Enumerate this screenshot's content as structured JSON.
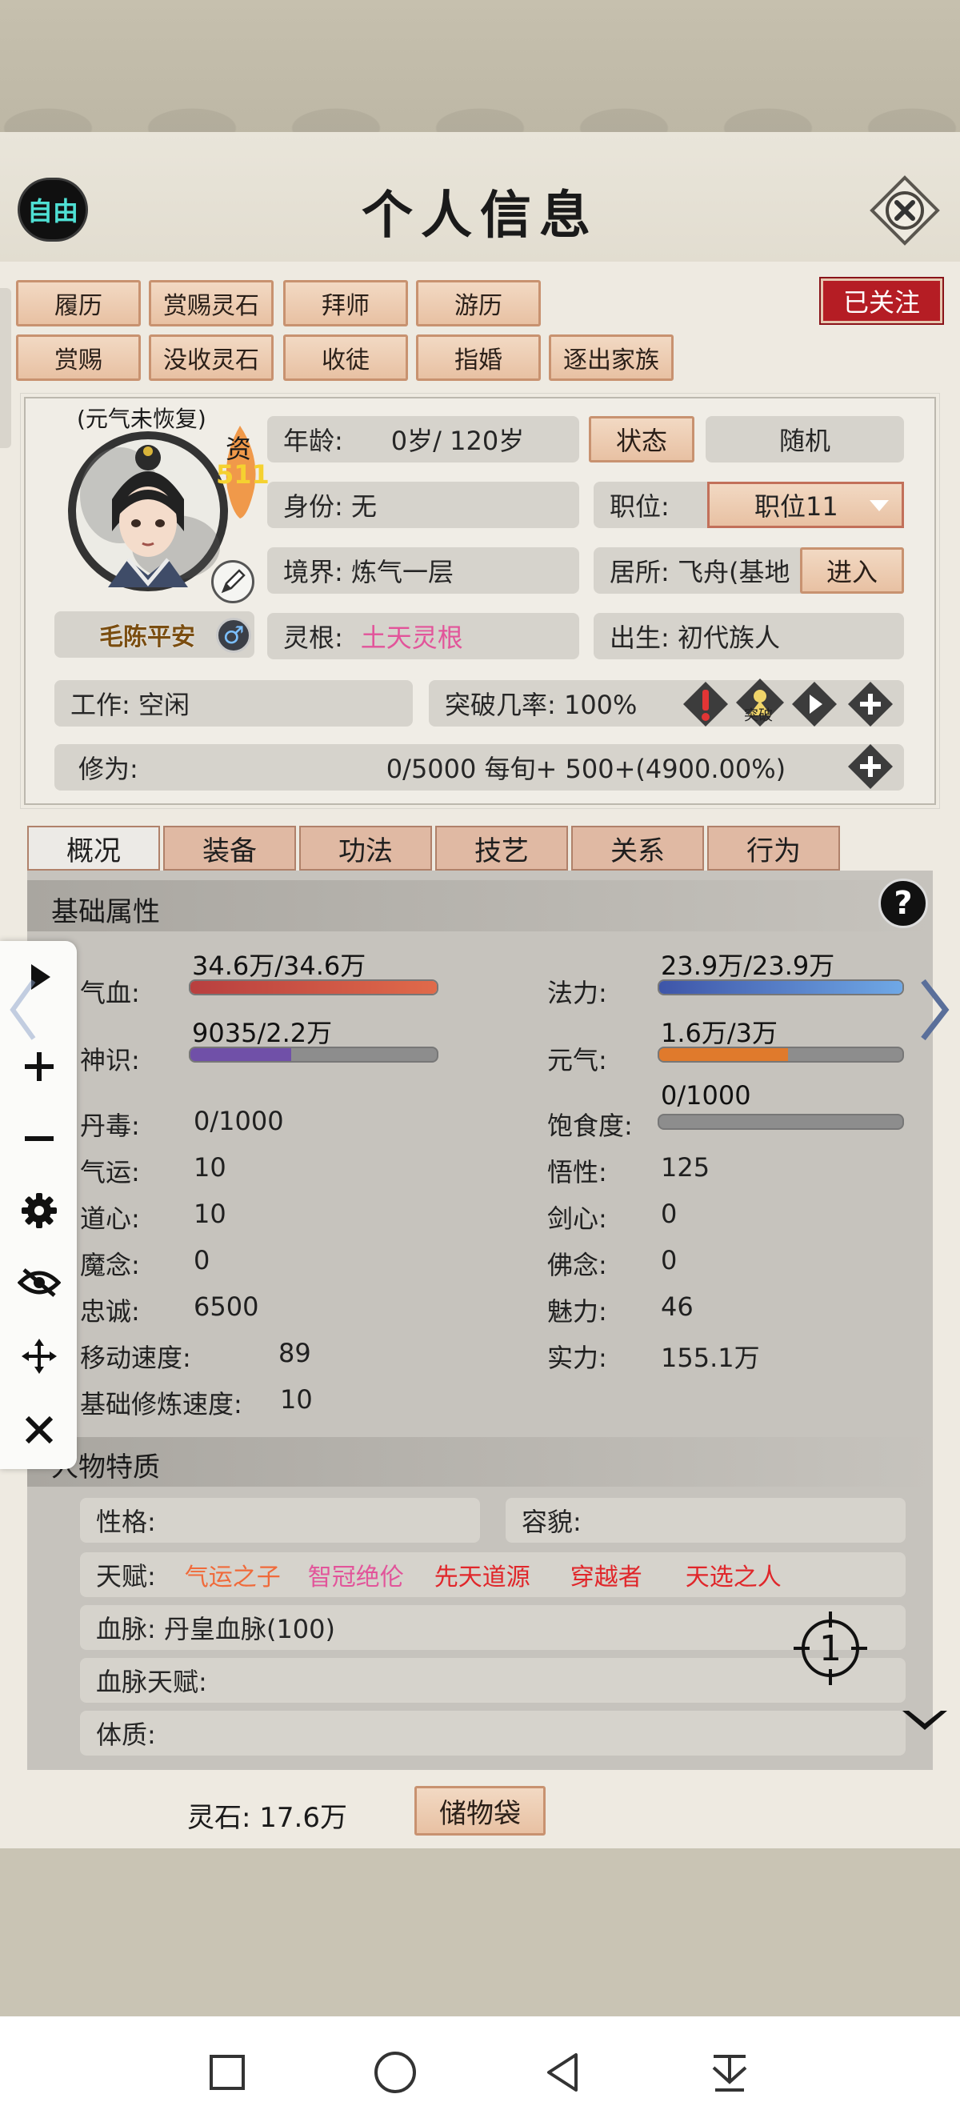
{
  "header": {
    "title": "个人信息",
    "free_badge": "自由",
    "followed_badge": "已关注"
  },
  "actions": {
    "row1": [
      "履历",
      "赏赐灵石",
      "拜师",
      "游历"
    ],
    "row2": [
      "赏赐",
      "没收灵石",
      "收徒",
      "指婚",
      "逐出家族"
    ]
  },
  "profile": {
    "status_note": "(元气未恢复)",
    "aptitude_label": "资",
    "aptitude_value": "511",
    "name": "毛陈平安",
    "age_label": "年龄:",
    "age_value": "0岁/ 120岁",
    "status_button": "状态",
    "random_button": "随机",
    "identity": "身份:  无",
    "position_label": "职位:",
    "position_value": "职位11",
    "realm": "境界:  炼气一层",
    "residence": "居所: 飞舟(基地",
    "enter_button": "进入",
    "root_label": "灵根:",
    "root_value": "土天灵根",
    "birth": "出生:   初代族人",
    "work": "工作: 空闲",
    "breakthrough": "突破几率:  100%",
    "breakthrough_tag": "突破",
    "cultivation_label": "修为:",
    "cultivation_value": "0/5000  每旬+   500+(4900.00%)"
  },
  "tabs": [
    "概况",
    "装备",
    "功法",
    "技艺",
    "关系",
    "行为"
  ],
  "attributes": {
    "section_title": "基础属性",
    "help": "?",
    "blood_label": "气血:",
    "blood_value": "34.6万/34.6万",
    "blood_fill": 1.0,
    "mana_label": "法力:",
    "mana_value": "23.9万/23.9万",
    "mana_fill": 1.0,
    "sense_label": "神识:",
    "sense_value": "9035/2.2万",
    "sense_fill": 0.41,
    "vital_label": "元气:",
    "vital_value": "1.6万/3万",
    "vital_fill": 0.53,
    "toxin": "丹毒:",
    "toxin_value": "0/1000",
    "satiety_label": "饱食度:",
    "satiety_value": "0/1000",
    "satiety_fill": 0.0,
    "luck": "气运:",
    "luck_value": "10",
    "comprehension": "悟性:",
    "comprehension_value": "125",
    "dao_heart": "道心:",
    "dao_heart_value": "10",
    "sword_heart": "剑心:",
    "sword_heart_value": "0",
    "demon": "魔念:",
    "demon_value": "0",
    "buddha": "佛念:",
    "buddha_value": "0",
    "loyalty": "忠诚:",
    "loyalty_value": "6500",
    "charm": "魅力:",
    "charm_value": "46",
    "move_speed": "移动速度:",
    "move_speed_value": "89",
    "strength": "实力:",
    "strength_value": "155.1万",
    "base_speed": "基础修炼速度:",
    "base_speed_value": "10"
  },
  "traits": {
    "section_title": "人物特质",
    "personality": "性格:",
    "looks": "容貌:",
    "talent_label": "天赋:",
    "talents": [
      "气运之子",
      "智冠绝伦",
      "先天道源",
      "穿越者",
      "天选之人"
    ],
    "bloodline": "血脉:  丹皇血脉(100)",
    "bloodline_talent": "血脉天赋:",
    "physique": "体质:"
  },
  "footer": {
    "spirit_stone": "灵石: 17.6万",
    "bag_button": "储物袋"
  },
  "floating_tools": [
    "play-icon",
    "plus-icon",
    "minus-icon",
    "gear-icon",
    "eye-off-icon",
    "move-icon",
    "close-icon"
  ],
  "crosshair_number": "1",
  "colors": {
    "accent_red": "#b51d24",
    "talent_orange": "#f06a3a",
    "talent_pink": "#e2549a",
    "talent_red": "#e0262a"
  }
}
